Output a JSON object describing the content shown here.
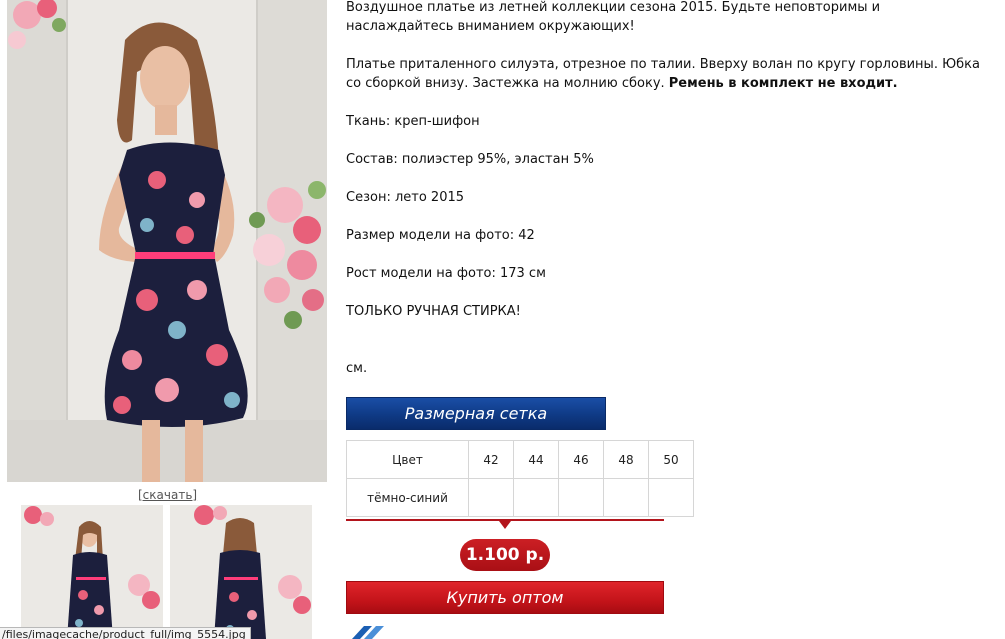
{
  "product": {
    "description": [
      "Воздушное платье из летней коллекции сезона 2015. Будьте неповторимы и наслаждайтесь вниманием окружающих!",
      "Платье приталенного силуэта, отрезное по талии. Вверху волан по кругу горловины. Юбка со сборкой внизу. Застежка на молнию сбоку.",
      "Ремень в комплект не входит."
    ],
    "fabric": "Ткань: креп-шифон",
    "composition": "Состав: полиэстер 95%, эластан 5%",
    "season": "Сезон: лето 2015",
    "model_size": "Размер модели на фото: 42",
    "model_height": "Рост модели на фото: 173 см",
    "care": "ТОЛЬКО РУЧНАЯ СТИРКА!",
    "unit": "см."
  },
  "gallery": {
    "download_label": "[скачать]",
    "status_url": "/files/imagecache/product_full/img_5554.jpg"
  },
  "size_chart": {
    "title": "Размерная сетка",
    "header_label": "Цвет",
    "sizes": [
      "42",
      "44",
      "46",
      "48",
      "50"
    ],
    "rows": [
      {
        "color": "тёмно-синий",
        "cells": [
          "",
          "",
          "",
          "",
          ""
        ]
      }
    ]
  },
  "price": {
    "value": "1.100 р."
  },
  "actions": {
    "buy_wholesale": "Купить оптом"
  },
  "colors": {
    "accent_red": "#c4141a",
    "header_blue": "#0f3a85",
    "dress_navy": "#1c1f3d",
    "flower_pink": "#e8607a",
    "belt_pink": "#ff3d7a"
  }
}
